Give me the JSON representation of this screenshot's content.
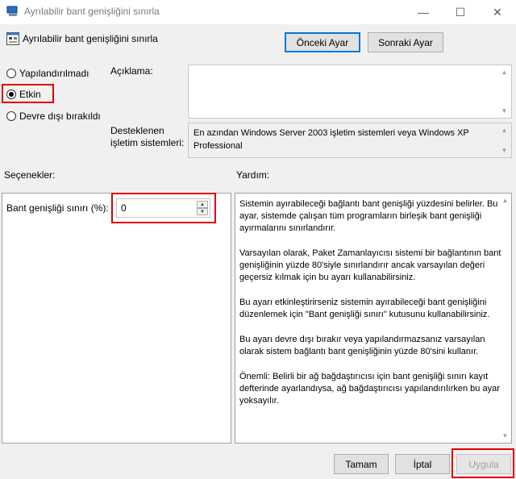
{
  "window": {
    "title": "Ayrılabilir bant genişliğini sınırla",
    "minimize_glyph": "—",
    "maximize_glyph": "☐",
    "close_glyph": "✕"
  },
  "header": {
    "policy_title": "Ayrılabilir bant genişliğini sınırla",
    "prev_button": "Önceki Ayar",
    "next_button": "Sonraki Ayar"
  },
  "state": {
    "not_configured": "Yapılandırılmadı",
    "enabled": "Etkin",
    "disabled": "Devre dışı bırakıldı",
    "selected": "enabled"
  },
  "comment": {
    "label": "Açıklama:",
    "value": ""
  },
  "supported_on": {
    "label_line1": "Desteklenen",
    "label_line2": "işletim sistemleri:",
    "value": "En azından Windows Server 2003 işletim sistemleri veya Windows XP Professional"
  },
  "options": {
    "heading": "Seçenekler:",
    "bandwidth_label": "Bant genişliği sınırı (%):",
    "bandwidth_value": "0"
  },
  "help": {
    "heading": "Yardım:",
    "paragraphs": [
      "Sistemin ayırabileceği bağlantı bant genişliği yüzdesini belirler. Bu ayar, sistemde çalışan tüm programların birleşik bant genişliği ayırmalarını sınırlandırır.",
      "Varsayılan olarak, Paket Zamanlayıcısı sistemi bir bağlantının bant genişliğinin yüzde 80'siyle sınırlandırır ancak varsayılan değeri geçersiz kılmak için bu ayarı kullanabilirsiniz.",
      "Bu ayarı etkinleştirirseniz sistemin ayırabileceği bant genişliğini düzenlemek için \"Bant genişliği sınırı\" kutusunu kullanabilirsiniz.",
      "Bu ayarı devre dışı bırakır veya yapılandırmazsanız varsayılan olarak sistem bağlantı bant genişliğinin yüzde 80'sini kullanır.",
      "Önemli: Belirli bir ağ bağdaştırıcısı için bant genişliği sınırı kayıt defterinde ayarlandıysa, ağ bağdaştırıcısı yapılandırılırken bu ayar yoksayılır."
    ]
  },
  "footer": {
    "ok": "Tamam",
    "cancel": "İptal",
    "apply": "Uygula"
  },
  "colors": {
    "highlight": "#e00000",
    "window_bg": "#f0f0f0",
    "focus_border": "#0078d7"
  }
}
